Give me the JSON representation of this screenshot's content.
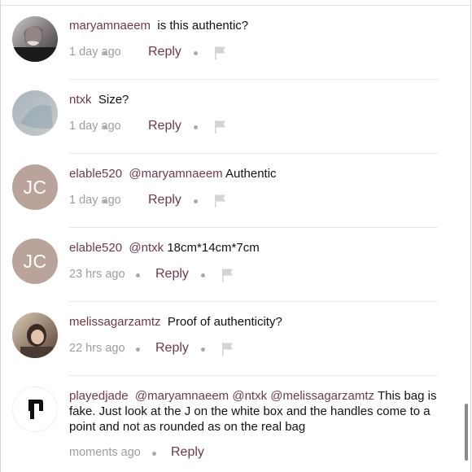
{
  "comments": [
    {
      "username": "maryamnaeem",
      "mentions": [],
      "text": "is this authentic?",
      "time": "1 day ago",
      "reply_label": "Reply",
      "has_flag": true,
      "avatar": {
        "type": "photo",
        "colors": [
          "#c9c5c8",
          "#3a3235"
        ]
      }
    },
    {
      "username": "ntxk",
      "mentions": [],
      "text": "Size?",
      "time": "1 day ago",
      "reply_label": "Reply",
      "has_flag": true,
      "avatar": {
        "type": "photo",
        "colors": [
          "#a8b4bd",
          "#c7cbc9"
        ]
      }
    },
    {
      "username": "elable520",
      "mentions": [
        "@maryamnaeem"
      ],
      "text": "Authentic",
      "time": "1 day ago",
      "reply_label": "Reply",
      "has_flag": true,
      "avatar": {
        "type": "initials",
        "initials": "JC",
        "color": "#b9a39b"
      }
    },
    {
      "username": "elable520",
      "mentions": [
        "@ntxk"
      ],
      "text": "18cm*14cm*7cm",
      "time": "23 hrs ago",
      "reply_label": "Reply",
      "has_flag": true,
      "avatar": {
        "type": "initials",
        "initials": "JC",
        "color": "#b9a39b"
      }
    },
    {
      "username": "melissagarzamtz",
      "mentions": [],
      "text": "Proof of authenticity?",
      "time": "22 hrs ago",
      "reply_label": "Reply",
      "has_flag": true,
      "avatar": {
        "type": "photo",
        "colors": [
          "#d9cbb2",
          "#5a4036"
        ]
      }
    },
    {
      "username": "playedjade",
      "mentions": [
        "@maryamnaeem",
        "@ntxk",
        "@melissagarzamtz"
      ],
      "text": "This bag is fake. Just look at the J on the white box and the handles come to a point and not as rounded as on the real bag",
      "time": "moments ago",
      "reply_label": "Reply",
      "has_flag": false,
      "avatar": {
        "type": "logo",
        "color": "#111111"
      }
    }
  ],
  "theme": {
    "username_color": "#6e3a46",
    "meta_color": "#9d9d9d",
    "initials_avatar_bg": "#b9a39b"
  }
}
